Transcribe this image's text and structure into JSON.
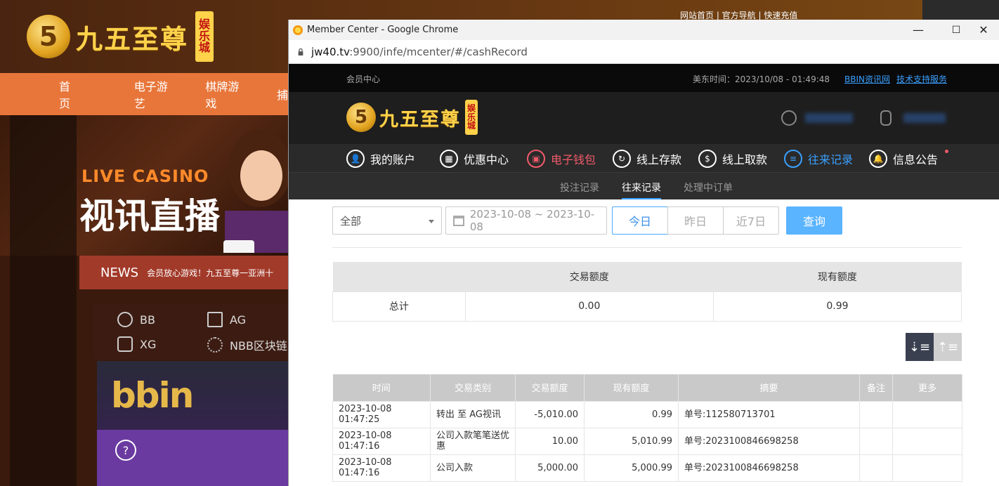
{
  "background": {
    "logo_text": "九五至尊",
    "logo_badge": [
      "娱",
      "乐",
      "城"
    ],
    "top_links": "网站首页 | 官方导航 | 快速充值",
    "nav": [
      "首页",
      "电子游艺",
      "棋牌游戏",
      "捕"
    ],
    "live_casino": "LIVE CASINO",
    "live_casino_cn": "视讯直播",
    "news_label": "NEWS",
    "news_text": "会员放心游戏！九五至尊一亚洲十",
    "games": [
      "BB",
      "AG",
      "XG",
      "NBB区块链"
    ],
    "bbin_logo": "bbin",
    "help": "?"
  },
  "window": {
    "title": "Member Center - Google Chrome",
    "url_host": "jw40.tv",
    "url_rest": ":9900/infe/mcenter/#/cashRecord",
    "minimize": "—",
    "maximize": "☐",
    "close": "✕"
  },
  "member": {
    "topstrip_title": "会员中心",
    "east_time": "美东时间：2023/10/08 - 01:49:48",
    "link_bbin": "BBIN资讯网",
    "link_support": "技术支持服务",
    "logo_text": "九五至尊",
    "logo_badge": [
      "娱",
      "乐",
      "城"
    ],
    "nav": [
      {
        "label": "我的账户",
        "icon": "user-icon"
      },
      {
        "label": "优惠中心",
        "icon": "gift-icon"
      },
      {
        "label": "电子钱包",
        "icon": "wallet-icon"
      },
      {
        "label": "线上存款",
        "icon": "deposit-icon"
      },
      {
        "label": "线上取款",
        "icon": "withdraw-icon"
      },
      {
        "label": "往来记录",
        "icon": "record-icon"
      },
      {
        "label": "信息公告",
        "icon": "bell-icon"
      }
    ],
    "subnav": [
      "投注记录",
      "往来记录",
      "处理中订单"
    ],
    "filter": {
      "type": "全部",
      "date_range": "2023-10-08 ~ 2023-10-08",
      "today": "今日",
      "yesterday": "昨日",
      "last7": "近7日",
      "query": "查询"
    },
    "summary": {
      "headers": [
        "",
        "交易额度",
        "现有额度"
      ],
      "row": [
        "总计",
        "0.00",
        "0.99"
      ]
    },
    "records": {
      "headers": [
        "时间",
        "交易类别",
        "交易额度",
        "现有额度",
        "摘要",
        "备注",
        "更多"
      ],
      "rows": [
        [
          "2023-10-08 01:47:25",
          "转出 至 AG视讯",
          "-5,010.00",
          "0.99",
          "单号:112580713701",
          "",
          ""
        ],
        [
          "2023-10-08 01:47:16",
          "公司入款笔笔送优惠",
          "10.00",
          "5,010.99",
          "单号:2023100846698258",
          "",
          ""
        ],
        [
          "2023-10-08 01:47:16",
          "公司入款",
          "5,000.00",
          "5,000.99",
          "单号:2023100846698258",
          "",
          ""
        ]
      ]
    }
  }
}
